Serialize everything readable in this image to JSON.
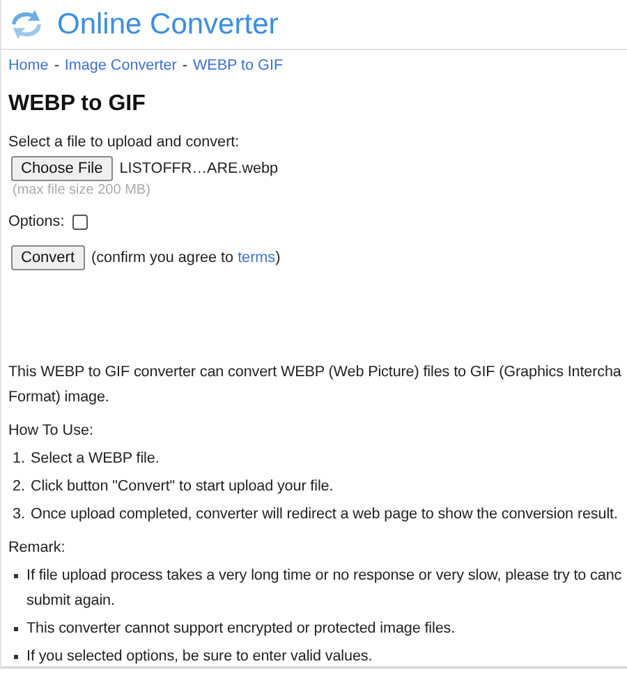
{
  "header": {
    "site_name": "Online Converter"
  },
  "breadcrumb": [
    {
      "label": "Home"
    },
    {
      "label": "Image Converter"
    },
    {
      "label": "WEBP to GIF"
    }
  ],
  "breadcrumb_separator": "-",
  "title": "WEBP to GIF",
  "upload": {
    "label": "Select a file to upload and convert:",
    "button": "Choose File",
    "file_name": "LISTOFFR…ARE.webp",
    "hint": "(max file size 200 MB)"
  },
  "options": {
    "label": "Options:",
    "checked": false
  },
  "convert": {
    "button": "Convert",
    "note_before": "(confirm you agree to ",
    "link": "terms",
    "note_after": ")"
  },
  "description": [
    "This WEBP to GIF converter can convert WEBP (Web Picture) files to GIF (Graphics Intercha",
    "Format) image."
  ],
  "how_to": {
    "heading": "How To Use:",
    "steps": [
      {
        "number": "1.",
        "lines": [
          "Select a WEBP file."
        ]
      },
      {
        "number": "2.",
        "lines": [
          "Click button \"Convert\" to start upload your file."
        ]
      },
      {
        "number": "3.",
        "lines": [
          "Once upload completed, converter will redirect a web page to show the conversion result."
        ]
      }
    ]
  },
  "remark": {
    "heading": "Remark:",
    "items": [
      {
        "lines": [
          "If file upload process takes a very long time or no response or very slow, please try to canc",
          "submit again."
        ]
      },
      {
        "lines": [
          "This converter cannot support encrypted or protected image files."
        ]
      },
      {
        "lines": [
          "If you selected options, be sure to enter valid values."
        ]
      }
    ]
  }
}
